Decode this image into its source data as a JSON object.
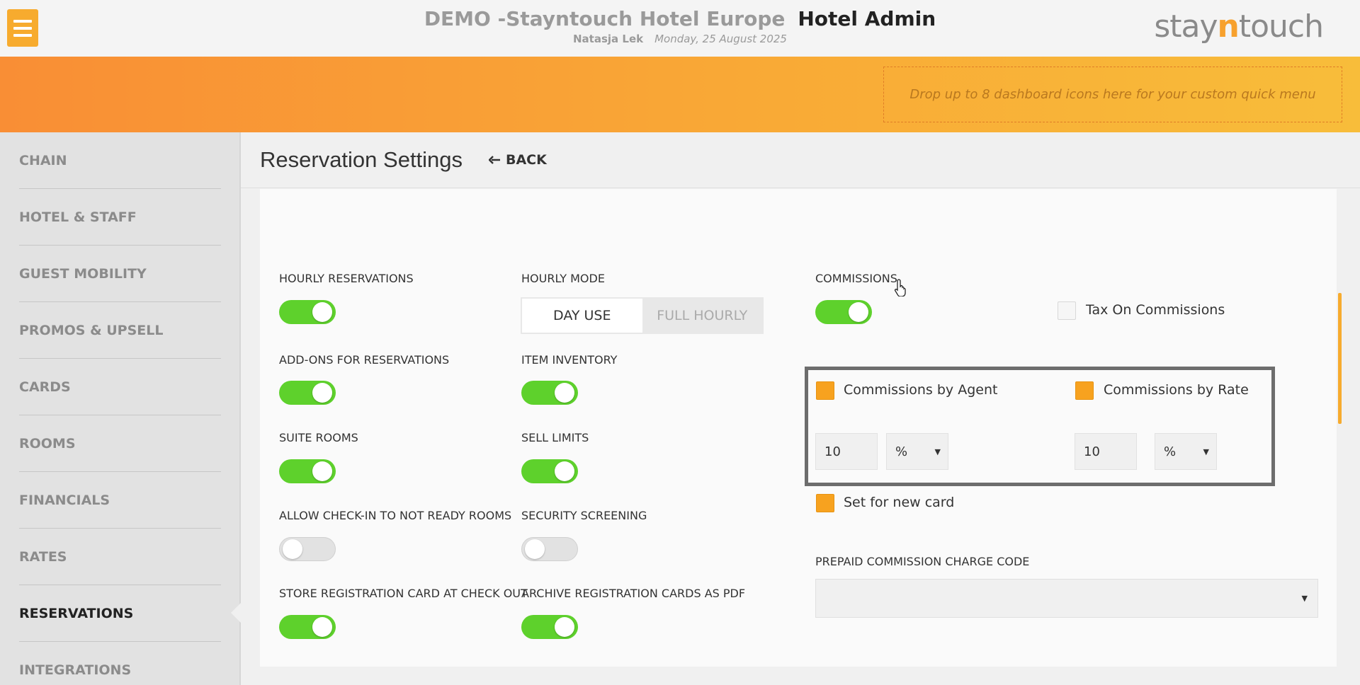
{
  "header": {
    "hotel_name": "DEMO -Stayntouch Hotel Europe",
    "app_name": "Hotel Admin",
    "user_name": "Natasja Lek",
    "date": "Monday, 25 August 2025",
    "logo_part1": "stay",
    "logo_part2": "n",
    "logo_part3": "touch"
  },
  "quick_menu": {
    "placeholder": "Drop up to 8 dashboard icons here for your custom quick menu"
  },
  "sidebar": {
    "items": [
      {
        "label": "CHAIN"
      },
      {
        "label": "HOTEL & STAFF"
      },
      {
        "label": "GUEST MOBILITY"
      },
      {
        "label": "PROMOS & UPSELL"
      },
      {
        "label": "CARDS"
      },
      {
        "label": "ROOMS"
      },
      {
        "label": "FINANCIALS"
      },
      {
        "label": "RATES"
      },
      {
        "label": "RESERVATIONS"
      },
      {
        "label": "INTEGRATIONS"
      }
    ],
    "active": "RESERVATIONS"
  },
  "page": {
    "title": "Reservation Settings",
    "back_label": "BACK"
  },
  "settings": {
    "hourly_reservations": {
      "label": "HOURLY RESERVATIONS",
      "on": true
    },
    "hourly_mode": {
      "label": "HOURLY MODE",
      "options": [
        "DAY USE",
        "FULL HOURLY"
      ],
      "selected": "DAY USE"
    },
    "addons": {
      "label": "ADD-ONS FOR RESERVATIONS",
      "on": true
    },
    "item_inventory": {
      "label": "ITEM INVENTORY",
      "on": true
    },
    "suite_rooms": {
      "label": "SUITE ROOMS",
      "on": true
    },
    "sell_limits": {
      "label": "SELL LIMITS",
      "on": true
    },
    "allow_checkin": {
      "label": "ALLOW CHECK-IN TO NOT READY ROOMS",
      "on": false
    },
    "security_screening": {
      "label": "SECURITY SCREENING",
      "on": false
    },
    "store_reg_card": {
      "label": "STORE REGISTRATION CARD AT CHECK OUT",
      "on": true
    },
    "archive_reg_cards": {
      "label": "ARCHIVE REGISTRATION CARDS AS PDF",
      "on": true
    }
  },
  "commissions": {
    "label": "COMMISSIONS",
    "on": true,
    "tax_on_commissions": {
      "label": "Tax On Commissions",
      "checked": false
    },
    "by_agent": {
      "label": "Commissions by Agent",
      "checked": true,
      "value": "10",
      "unit": "%"
    },
    "by_rate": {
      "label": "Commissions by Rate",
      "checked": true,
      "value": "10",
      "unit": "%"
    },
    "set_for_new_card": {
      "label": "Set for new card",
      "checked": true
    },
    "prepaid_charge_code": {
      "label": "PREPAID COMMISSION CHARGE CODE",
      "value": ""
    }
  },
  "colors": {
    "accent": "#f7ab2e",
    "toggle_on": "#5ed12c",
    "checkbox_on": "#f7a21f"
  }
}
